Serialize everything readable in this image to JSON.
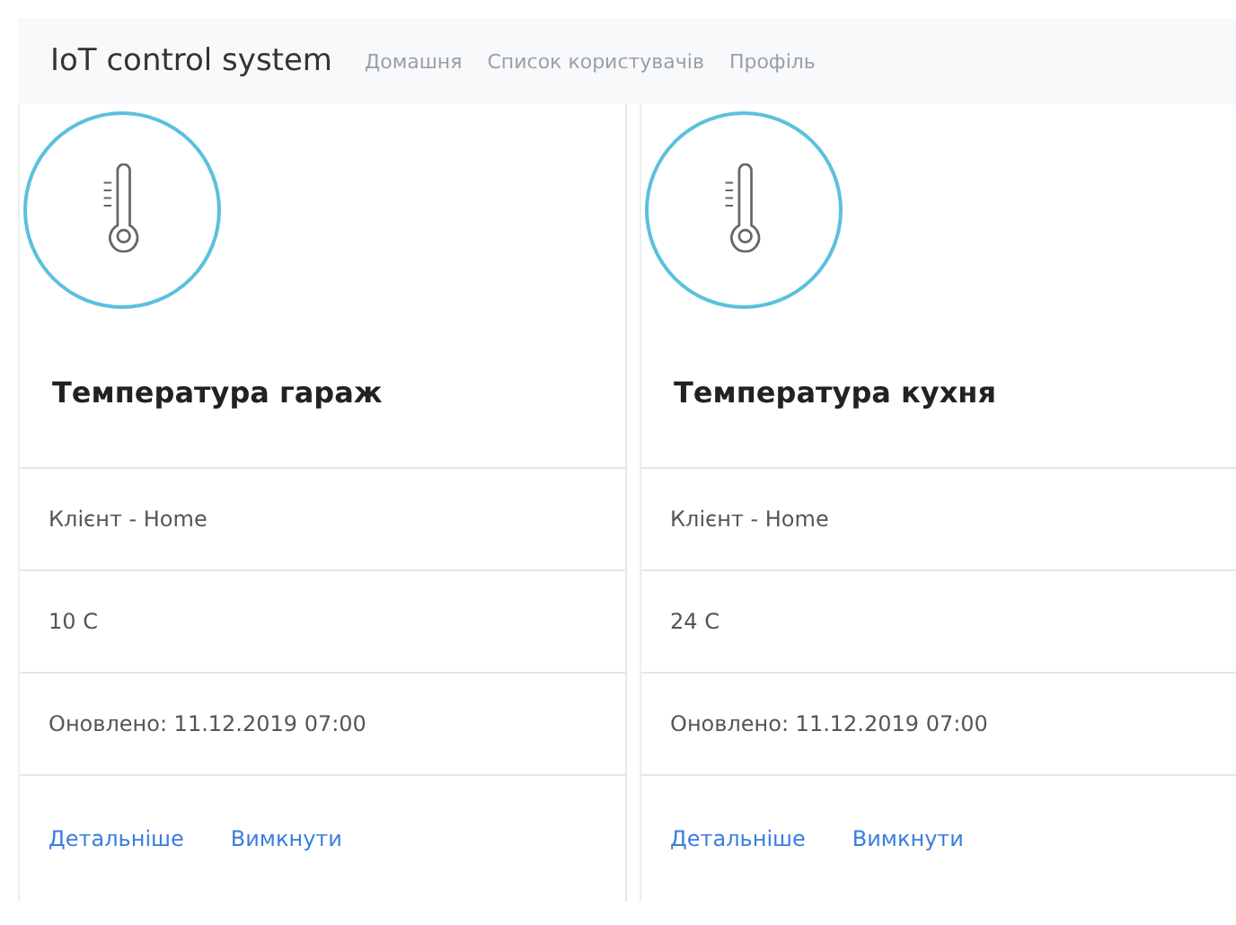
{
  "navbar": {
    "brand": "IoT control system",
    "links": [
      {
        "label": "Домашня"
      },
      {
        "label": "Список користувачів"
      },
      {
        "label": "Профіль"
      }
    ]
  },
  "cards": [
    {
      "title": "Температура гараж",
      "client": "Клієнт - Home",
      "value": "10 C",
      "updated": "Оновлено: 11.12.2019 07:00",
      "links": [
        "Детальніше",
        "Вимкнути"
      ]
    },
    {
      "title": "Температура кухня",
      "client": "Клієнт - Home",
      "value": "24 C",
      "updated": "Оновлено: 11.12.2019 07:00",
      "links": [
        "Детальніше",
        "Вимкнути"
      ]
    }
  ]
}
